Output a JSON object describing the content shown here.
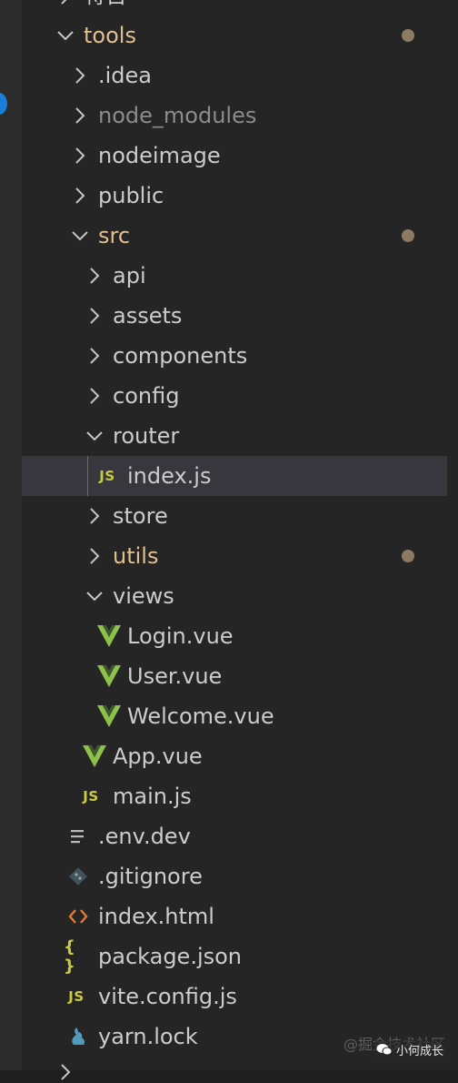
{
  "tree": {
    "top_partial_label": "将台",
    "rows": [
      {
        "label": "tools",
        "kind": "folder",
        "state": "open",
        "modified": true
      },
      {
        "label": ".idea",
        "kind": "folder",
        "state": "closed"
      },
      {
        "label": "node_modules",
        "kind": "folder",
        "state": "closed",
        "ignored": true
      },
      {
        "label": "nodeimage",
        "kind": "folder",
        "state": "closed"
      },
      {
        "label": "public",
        "kind": "folder",
        "state": "closed"
      },
      {
        "label": "src",
        "kind": "folder",
        "state": "open",
        "modified": true
      },
      {
        "label": "api",
        "kind": "folder",
        "state": "closed"
      },
      {
        "label": "assets",
        "kind": "folder",
        "state": "closed"
      },
      {
        "label": "components",
        "kind": "folder",
        "state": "closed"
      },
      {
        "label": "config",
        "kind": "folder",
        "state": "closed"
      },
      {
        "label": "router",
        "kind": "folder",
        "state": "open"
      },
      {
        "label": "index.js",
        "kind": "file",
        "icon": "js-file-icon",
        "selected": true
      },
      {
        "label": "store",
        "kind": "folder",
        "state": "closed"
      },
      {
        "label": "utils",
        "kind": "folder",
        "state": "closed",
        "modified": true
      },
      {
        "label": "views",
        "kind": "folder",
        "state": "open"
      },
      {
        "label": "Login.vue",
        "kind": "file",
        "icon": "vue-file-icon"
      },
      {
        "label": "User.vue",
        "kind": "file",
        "icon": "vue-file-icon"
      },
      {
        "label": "Welcome.vue",
        "kind": "file",
        "icon": "vue-file-icon"
      },
      {
        "label": "App.vue",
        "kind": "file",
        "icon": "vue-file-icon"
      },
      {
        "label": "main.js",
        "kind": "file",
        "icon": "js-file-icon"
      },
      {
        "label": ".env.dev",
        "kind": "file",
        "icon": "lines-file-icon"
      },
      {
        "label": ".gitignore",
        "kind": "file",
        "icon": "git-file-icon"
      },
      {
        "label": "index.html",
        "kind": "file",
        "icon": "html-file-icon"
      },
      {
        "label": "package.json",
        "kind": "file",
        "icon": "json-file-icon"
      },
      {
        "label": "vite.config.js",
        "kind": "file",
        "icon": "js-file-icon"
      },
      {
        "label": "yarn.lock",
        "kind": "file",
        "icon": "yarn-file-icon"
      }
    ],
    "js_badge": "JS",
    "json_badge": "{ }"
  },
  "watermark": "@掘金技术社区",
  "account_name": "小何成长",
  "colors": {
    "background": "#252526",
    "text": "#cccccc",
    "modified_text": "#e2c08d",
    "ignored_text": "#8c8c8c",
    "modified_dot": "#8c7b63",
    "selection": "#37373d",
    "js_icon": "#cbcb41",
    "vue_icon": "#8dc149",
    "html_icon": "#e37933",
    "json_icon": "#cbcb41",
    "git_icon": "#41535b",
    "yarn_icon": "#519aba"
  }
}
